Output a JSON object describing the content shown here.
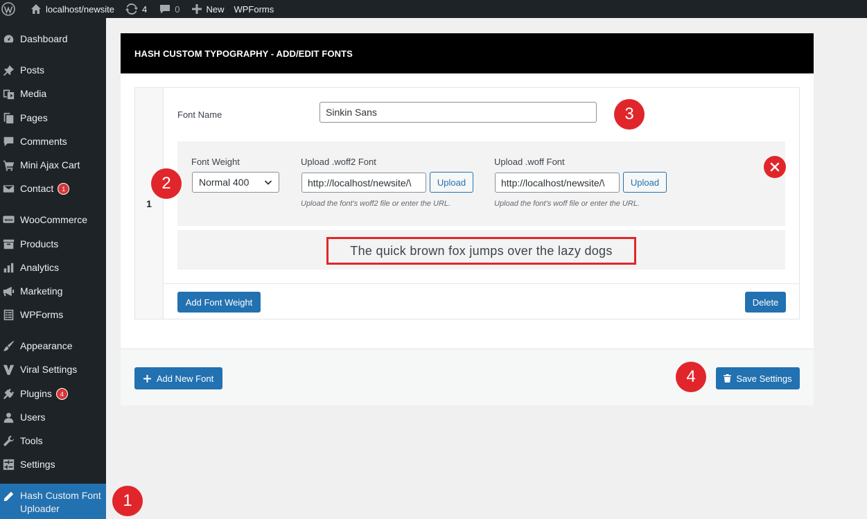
{
  "adminbar": {
    "site_name": "localhost/newsite",
    "updates_count": "4",
    "comments_count": "0",
    "new_label": "New",
    "wpforms_label": "WPForms"
  },
  "sidebar": {
    "items": [
      {
        "label": "Dashboard",
        "icon": "dashboard-icon"
      },
      {
        "label": "Posts",
        "icon": "pin-icon"
      },
      {
        "label": "Media",
        "icon": "media-icon"
      },
      {
        "label": "Pages",
        "icon": "pages-icon"
      },
      {
        "label": "Comments",
        "icon": "comment-icon"
      },
      {
        "label": "Mini Ajax Cart",
        "icon": "cart-icon"
      },
      {
        "label": "Contact",
        "icon": "envelope-icon",
        "badge": "1"
      },
      {
        "label": "WooCommerce",
        "icon": "woo-icon"
      },
      {
        "label": "Products",
        "icon": "archive-icon"
      },
      {
        "label": "Analytics",
        "icon": "bar-chart-icon"
      },
      {
        "label": "Marketing",
        "icon": "megaphone-icon"
      },
      {
        "label": "WPForms",
        "icon": "form-icon"
      },
      {
        "label": "Appearance",
        "icon": "brush-icon"
      },
      {
        "label": "Viral Settings",
        "icon": "v-logo-icon"
      },
      {
        "label": "Plugins",
        "icon": "plug-icon",
        "badge": "4"
      },
      {
        "label": "Users",
        "icon": "user-icon"
      },
      {
        "label": "Tools",
        "icon": "wrench-icon"
      },
      {
        "label": "Settings",
        "icon": "sliders-icon"
      }
    ],
    "active": {
      "label_line1": "Hash Custom Font",
      "label_line2": "Uploader",
      "icon": "pencil-icon"
    }
  },
  "panel": {
    "title": "HASH CUSTOM TYPOGRAPHY - ADD/EDIT FONTS",
    "font": {
      "index": "1",
      "name_label": "Font Name",
      "name_value": "Sinkin Sans",
      "weight_label": "Font Weight",
      "weight_value": "Normal 400",
      "woff2_label": "Upload .woff2 Font",
      "woff2_value": "http://localhost/newsite/\\",
      "woff2_hint": "Upload the font's woff2 file or enter the URL.",
      "woff_label": "Upload .woff Font",
      "woff_value": "http://localhost/newsite/\\",
      "woff_hint": "Upload the font's woff file or enter the URL.",
      "upload_label": "Upload",
      "preview_text": "The quick brown fox jumps over the lazy dogs",
      "add_weight_label": "Add Font Weight",
      "delete_label": "Delete"
    },
    "footer": {
      "add_new_font_label": "Add New Font",
      "save_settings_label": "Save Settings"
    }
  },
  "markers": [
    "1",
    "2",
    "3",
    "4"
  ],
  "colors": {
    "admin_dark": "#1d2327",
    "accent_blue": "#2271b1",
    "annotation_red": "#e0262b"
  }
}
